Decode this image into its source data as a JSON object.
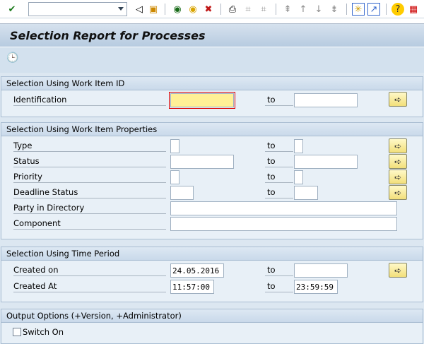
{
  "toolbar": {
    "icons": [
      "enter-icon",
      "back-icon",
      "save-icon",
      "back-green-icon",
      "exit-icon",
      "cancel-icon",
      "print-icon",
      "find-icon",
      "find-next-icon",
      "first-page-icon",
      "previous-page-icon",
      "next-page-icon",
      "last-page-icon",
      "create-session-icon",
      "shortcut-icon",
      "help-icon",
      "customize-layout-icon"
    ],
    "command_field": ""
  },
  "title": "Selection Report for Processes",
  "app_toolbar": {
    "icon": "execute-clock-icon"
  },
  "groups": {
    "work_item_id": {
      "title": "Selection Using Work Item ID",
      "rows": [
        {
          "label": "Identification",
          "from": "",
          "to_label": "to",
          "to": ""
        }
      ]
    },
    "properties": {
      "title": "Selection Using Work Item Properties",
      "rows": [
        {
          "label": "Type",
          "from": "",
          "to_label": "to",
          "to": ""
        },
        {
          "label": "Status",
          "from": "",
          "to_label": "to",
          "to": ""
        },
        {
          "label": "Priority",
          "from": "",
          "to_label": "to",
          "to": ""
        },
        {
          "label": "Deadline Status",
          "from": "",
          "to_label": "to",
          "to": ""
        },
        {
          "label": "Party in Directory",
          "value": ""
        },
        {
          "label": "Component",
          "value": ""
        }
      ]
    },
    "time": {
      "title": "Selection Using Time Period",
      "rows": [
        {
          "label": "Created on",
          "from": "24.05.2016",
          "to_label": "to",
          "to": ""
        },
        {
          "label": "Created At",
          "from": "11:57:00",
          "to_label": "to",
          "to": "23:59:59"
        }
      ]
    },
    "output": {
      "title": "Output Options (+Version, +Administrator)",
      "checkbox_label": "Switch On",
      "checked": false
    }
  },
  "colors": {
    "focus_field": "#fff096",
    "button": "#f2df7a",
    "header": "#c9d9ea"
  }
}
